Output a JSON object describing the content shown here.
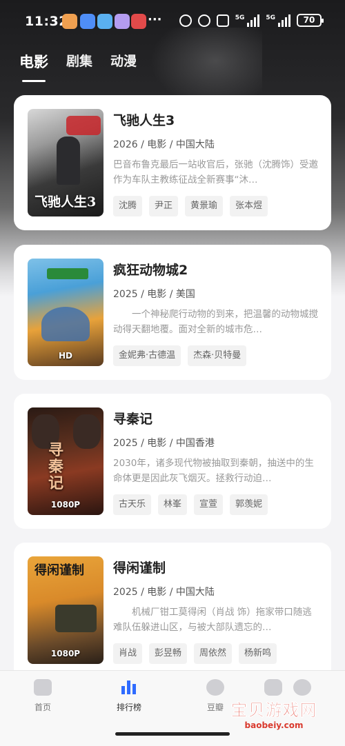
{
  "status_bar": {
    "time": "11:32",
    "more": "···",
    "net1": "5G",
    "net2": "5G",
    "battery": "70"
  },
  "tabs": [
    {
      "label": "电影"
    },
    {
      "label": "剧集"
    },
    {
      "label": "动漫"
    }
  ],
  "movies": [
    {
      "title": "飞驰人生3",
      "meta": "2026 / 电影 / 中国大陆",
      "description": "巴音布鲁克最后一站收官后，张驰（沈腾饰）受邀作为车队主教练征战全新赛事“沐…",
      "tags": [
        "沈腾",
        "尹正",
        "黄景瑜",
        "张本煜"
      ],
      "poster_text": "飞驰人生3",
      "badge": ""
    },
    {
      "title": "疯狂动物城2",
      "meta": "2025 / 电影 / 美国",
      "description": "　　一个神秘爬行动物的到来，把温馨的动物城搅动得天翻地覆。面对全新的城市危…",
      "tags": [
        "金妮弗·古德温",
        "杰森·贝特曼"
      ],
      "poster_text": "",
      "badge": "HD"
    },
    {
      "title": "寻秦记",
      "meta": "2025 / 电影 / 中国香港",
      "description": "2030年，诸多现代物被抽取到秦朝，抽送中的生命体更是因此灰飞烟灭。拯救行动迫…",
      "tags": [
        "古天乐",
        "林峯",
        "宣萱",
        "郭羡妮"
      ],
      "poster_text": "寻秦记",
      "badge": "1080P"
    },
    {
      "title": "得闲谨制",
      "meta": "2025 / 电影 / 中国大陆",
      "description": "　　机械厂钳工莫得闲（肖战 饰）拖家带口随逃难队伍躲进山区，与被大部队遗忘的…",
      "tags": [
        "肖战",
        "彭昱畅",
        "周依然",
        "杨新鸣"
      ],
      "poster_text": "得闲谨制",
      "badge": "1080P"
    }
  ],
  "bottom_nav": [
    {
      "label": "首页"
    },
    {
      "label": "排行榜"
    },
    {
      "label": "豆瓣"
    },
    {
      "label": ""
    },
    {
      "label": ""
    }
  ],
  "watermark": {
    "title": "宝贝游戏网",
    "url": "baobeiy.com"
  },
  "colors": {
    "accent": "#2f6bff",
    "watermark": "#e0463a"
  }
}
